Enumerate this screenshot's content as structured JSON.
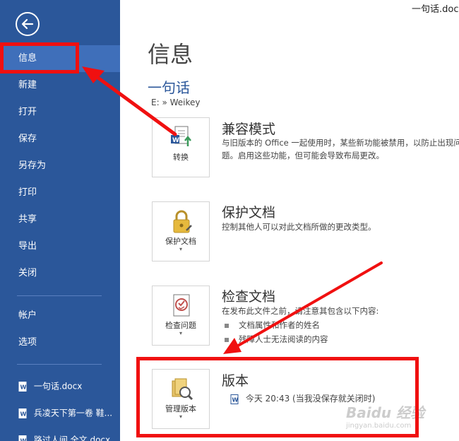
{
  "window": {
    "filename": "一句话.doc"
  },
  "sidebar": {
    "items": [
      {
        "label": "信息",
        "active": true
      },
      {
        "label": "新建"
      },
      {
        "label": "打开"
      },
      {
        "label": "保存"
      },
      {
        "label": "另存为"
      },
      {
        "label": "打印"
      },
      {
        "label": "共享"
      },
      {
        "label": "导出"
      },
      {
        "label": "关闭"
      }
    ],
    "account_items": [
      {
        "label": "帐户"
      },
      {
        "label": "选项"
      }
    ],
    "recent": [
      {
        "label": "一句话.docx"
      },
      {
        "label": "兵凌天下第一卷  鞋..."
      },
      {
        "label": "路过人间 全文.docx"
      }
    ],
    "colors": {
      "background": "#2b579a",
      "active": "#3f6fba"
    }
  },
  "main": {
    "page_title": "信息",
    "doc_title": "一句话",
    "doc_path": "E: » Weikey",
    "sections": {
      "compat": {
        "button_label": "转换",
        "title": "兼容模式",
        "description": "与旧版本的 Office 一起使用时，某些新功能被禁用，以防止出现问题。启用这些功能，但可能会导致布局更改。"
      },
      "protect": {
        "button_label": "保护文档",
        "title": "保护文档",
        "description": "控制其他人可以对此文档所做的更改类型。"
      },
      "inspect": {
        "button_label": "检查问题",
        "title": "检查文档",
        "description": "在发布此文件之前，请注意其包含以下内容:",
        "bullets": [
          "文档属性和作者的姓名",
          "残障人士无法阅读的内容"
        ]
      },
      "versions": {
        "button_label": "管理版本",
        "title": "版本",
        "entry": "今天 20:43 (当我没保存就关闭时)"
      }
    }
  },
  "annotation": {
    "color": "#f01010"
  },
  "watermark": {
    "text": "Baidu 经验",
    "sub": "jingyan.baidu.com"
  }
}
